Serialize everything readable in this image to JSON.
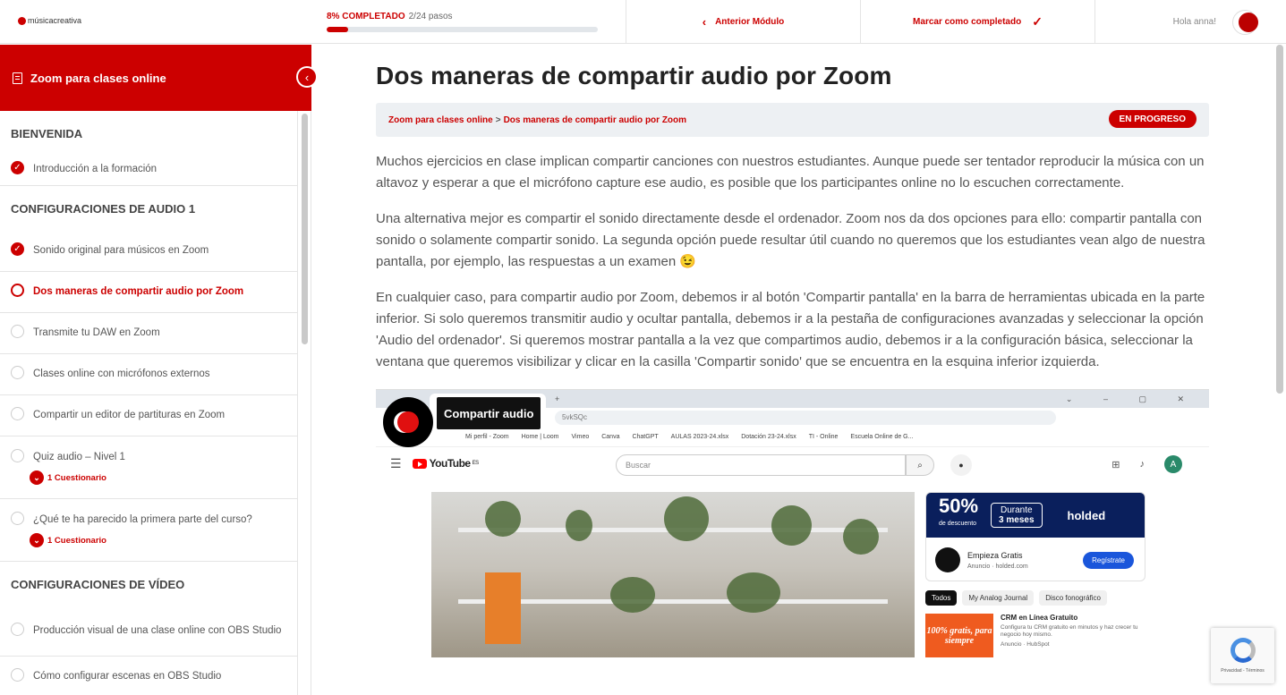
{
  "header": {
    "logo_text": "músicacreativa",
    "progress_label": "8% COMPLETADO",
    "progress_steps": "2/24 pasos",
    "progress_fraction": 0.08,
    "prev_module": "Anterior Módulo",
    "mark_complete": "Marcar como completado",
    "greeting": "Hola anna!"
  },
  "sidebar": {
    "course_title": "Zoom para clases online",
    "sections": [
      {
        "title": "BIENVENIDA",
        "items": [
          {
            "label": "Introducción a la formación",
            "status": "done"
          }
        ]
      },
      {
        "title": "CONFIGURACIONES DE AUDIO 1",
        "items": [
          {
            "label": "Sonido original para músicos en Zoom",
            "status": "done"
          },
          {
            "label": "Dos maneras de compartir audio por Zoom",
            "status": "current"
          },
          {
            "label": "Transmite tu DAW en Zoom",
            "status": "todo"
          },
          {
            "label": "Clases online con micrófonos externos",
            "status": "todo"
          },
          {
            "label": "Compartir un editor de partituras en Zoom",
            "status": "todo"
          },
          {
            "label": "Quiz audio – Nivel 1",
            "status": "todo",
            "quiz": "1 Cuestionario"
          },
          {
            "label": "¿Qué te ha parecido la primera parte del curso?",
            "status": "todo",
            "quiz": "1 Cuestionario"
          }
        ]
      },
      {
        "title": "CONFIGURACIONES DE VÍDEO",
        "items": [
          {
            "label": "Producción visual de una clase online con OBS Studio",
            "status": "todo"
          },
          {
            "label": "Cómo configurar escenas en OBS Studio",
            "status": "todo"
          }
        ]
      }
    ]
  },
  "main": {
    "title": "Dos maneras de compartir audio por Zoom",
    "breadcrumb_course": "Zoom para clases online",
    "breadcrumb_sep": ">",
    "breadcrumb_lesson": "Dos maneras de compartir audio por Zoom",
    "status_badge": "EN PROGRESO",
    "paragraphs": [
      "Muchos ejercicios en clase implican compartir canciones con nuestros estudiantes. Aunque puede ser tentador reproducir la música con un altavoz y esperar a que el micrófono capture ese audio, es posible que los participantes online no lo escuchen correctamente.",
      "Una alternativa mejor es compartir el sonido directamente desde el ordenador. Zoom nos da dos opciones para ello: compartir pantalla con sonido o solamente compartir sonido. La segunda opción puede resultar útil cuando no queremos que los estudiantes vean algo de nuestra pantalla, por ejemplo, las respuestas a un examen 😉",
      "En cualquier caso, para compartir audio por Zoom, debemos ir al botón 'Compartir pantalla' en la barra de herramientas ubicada en la parte inferior. Si solo queremos transmitir audio y ocultar pantalla, debemos ir a la pestaña de configuraciones avanzadas y seleccionar la opción 'Audio del ordenador'. Si queremos mostrar pantalla a la vez que compartimos audio, debemos ir a la configuración básica, seleccionar la ventana que queremos visibilizar y clicar en la casilla 'Compartir sonido' que se encuentra en la esquina inferior izquierda."
    ],
    "embed": {
      "tooltip": "Compartir audio",
      "url_fragment": "5vkSQc",
      "bookmarks": [
        "Mi perfil - Zoom",
        "Home | Loom",
        "Vimeo",
        "Canva",
        "ChatGPT",
        "AULAS 2023-24.xlsx",
        "Dotación 23-24.xlsx",
        "TI - Online",
        "Escuela Online de G..."
      ],
      "yt_search_placeholder": "Buscar",
      "yt_logo": "YouTube",
      "yt_country": "ES",
      "account_initial": "A",
      "ad_percent": "50%",
      "ad_percent_sub": "de descuento",
      "ad_duration_1": "Durante",
      "ad_duration_2": "3 meses",
      "ad_brand": "holded",
      "ad_cta_title": "Empieza Gratis",
      "ad_cta_meta": "Anuncio · holded.com",
      "ad_button": "Regístrate",
      "chips": [
        "Todos",
        "My Analog Journal",
        "Disco fonográfico"
      ],
      "crm_image_text": "100% gratis, para siempre",
      "crm_title": "CRM en Línea Gratuito",
      "crm_desc": "Configura tu CRM gratuito en minutos y haz crecer tu negocio hoy mismo.",
      "crm_meta": "Anuncio · HubSpot"
    }
  },
  "recaptcha": {
    "text": "Privacidad - Términos"
  },
  "colors": {
    "brand": "#cc0000",
    "breadcrumb_bg": "#edf0f3"
  }
}
